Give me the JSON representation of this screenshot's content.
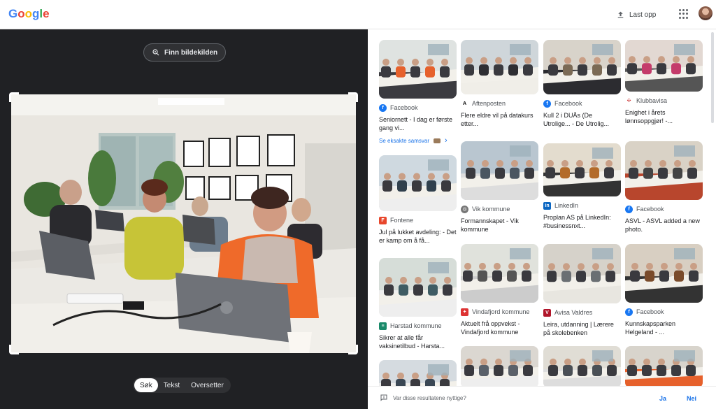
{
  "header": {
    "logo_letters": [
      {
        "ch": "G",
        "color": "#4285f4"
      },
      {
        "ch": "o",
        "color": "#ea4335"
      },
      {
        "ch": "o",
        "color": "#fbbc05"
      },
      {
        "ch": "g",
        "color": "#4285f4"
      },
      {
        "ch": "l",
        "color": "#34a853"
      },
      {
        "ch": "e",
        "color": "#ea4335"
      }
    ],
    "upload_label": "Last opp"
  },
  "left": {
    "find_source_label": "Finn bildekilden",
    "tabs": [
      {
        "label": "Søk",
        "active": true
      },
      {
        "label": "Tekst",
        "active": false
      },
      {
        "label": "Oversetter",
        "active": false
      }
    ]
  },
  "results": [
    {
      "source": "Facebook",
      "favicon": "facebook-icon",
      "title": "Seniornett - I dag er første gang vi...",
      "exact_match": "Se eksakte samsvar"
    },
    {
      "source": "Aftenposten",
      "favicon": "aftenposten-icon",
      "title": "Flere eldre vil på datakurs etter..."
    },
    {
      "source": "Facebook",
      "favicon": "facebook-icon",
      "title": "Kull 2 i DUÅs (De Utrolige... - De Utrolig..."
    },
    {
      "source": "Klubbavisa",
      "favicon": "klubbavisa-icon",
      "title": "Enighet i årets lønnsoppgjør! -..."
    },
    {
      "source": "Fontene",
      "favicon": "fontene-icon",
      "title": "Jul på lukket avdeling: - Det er kamp om å få..."
    },
    {
      "source": "Vik kommune",
      "favicon": "globe-icon",
      "title": "Formannskapet - Vik kommune"
    },
    {
      "source": "LinkedIn",
      "favicon": "linkedin-icon",
      "title": "Proplan AS på LinkedIn: #businessnxt..."
    },
    {
      "source": "Facebook",
      "favicon": "facebook-icon",
      "title": "ASVL - ASVL added a new photo."
    },
    {
      "source": "Harstad kommune",
      "favicon": "harstad-icon",
      "title": "Sikrer at alle får vaksinetilbud - Harsta..."
    },
    {
      "source": "Vindafjord kommune",
      "favicon": "vindafjord-icon",
      "title": "Aktuelt frå oppvekst - Vindafjord kommune"
    },
    {
      "source": "Avisa Valdres",
      "favicon": "valdres-icon",
      "title": "Leira, utdanning | Lærere på skolebenken"
    },
    {
      "source": "Facebook",
      "favicon": "facebook-icon",
      "title": "Kunnskapsparken Helgeland - ..."
    },
    {
      "source": "",
      "favicon": "",
      "title": ""
    },
    {
      "source": "",
      "favicon": "",
      "title": ""
    },
    {
      "source": "",
      "favicon": "",
      "title": ""
    },
    {
      "source": "",
      "favicon": "",
      "title": ""
    }
  ],
  "feedback": {
    "question": "Var disse resultatene nyttige?",
    "yes_label": "Ja",
    "no_label": "Nei"
  },
  "colors": {
    "facebook": "#1877f2",
    "linkedin": "#0a66c2",
    "fontene": "#e8472c",
    "vindafjord": "#d33",
    "valdres": "#b0152a",
    "harstad": "#1a8a6a",
    "accent": "#1a73e8"
  }
}
